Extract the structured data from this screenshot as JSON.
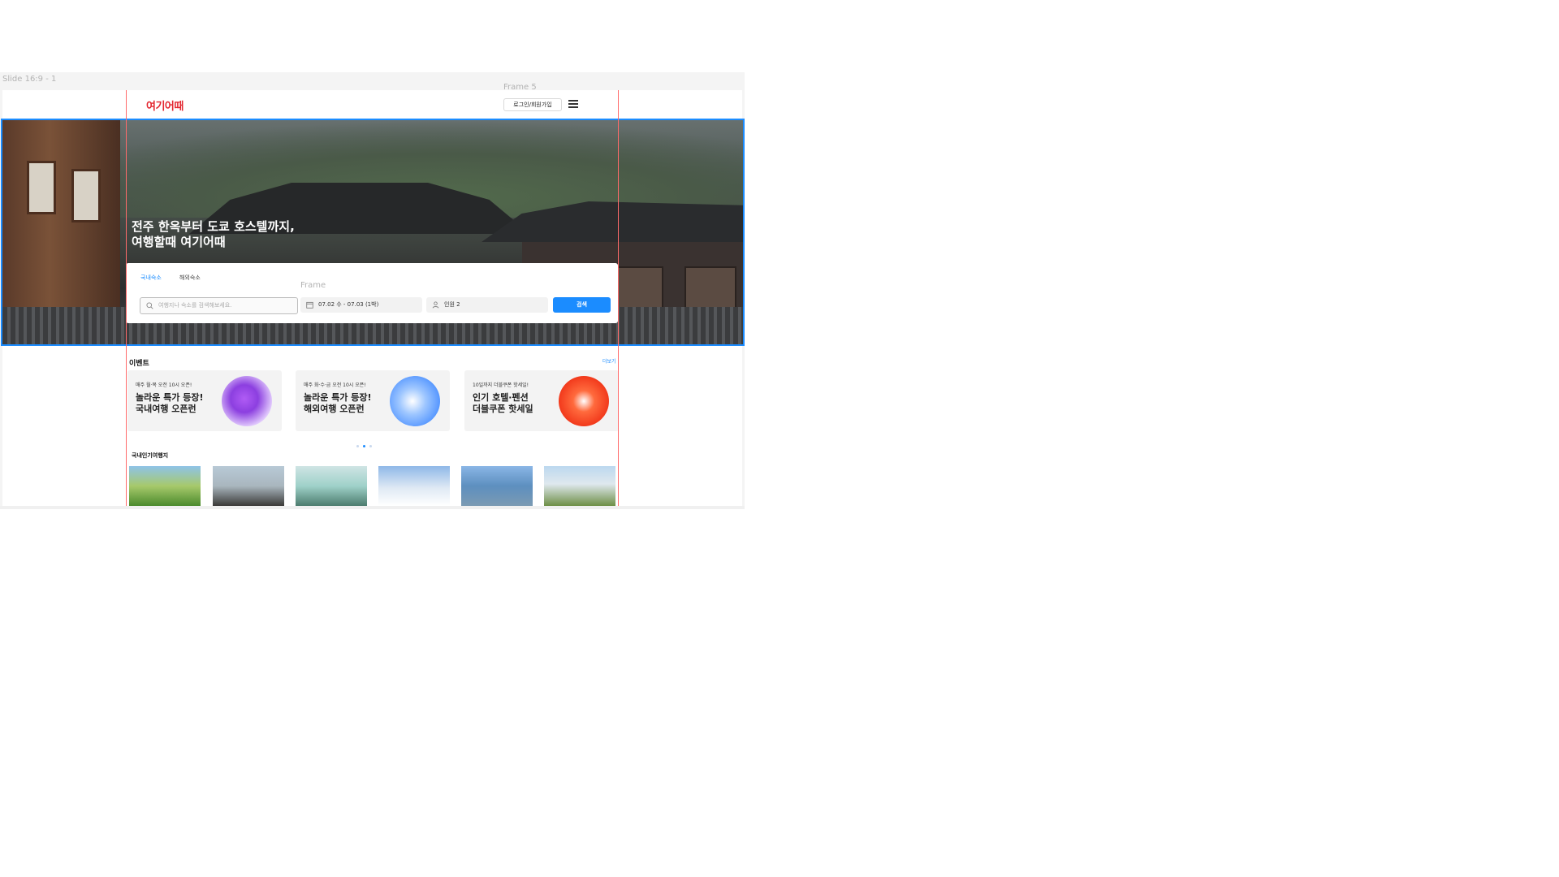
{
  "canvas": {
    "slide_label": "Slide 16:9 - 1",
    "frame_label": "Frame 5",
    "inner_frame_label": "Frame"
  },
  "header": {
    "logo": "여기어때",
    "login_label": "로그인/회원가입",
    "menu_icon": "hamburger-menu-icon"
  },
  "hero": {
    "title_line1": "전주 한옥부터 도쿄 호스텔까지,",
    "title_line2": "여행할때 여기어때"
  },
  "search": {
    "tabs": [
      "국내숙소",
      "해외숙소"
    ],
    "active_tab": "국내숙소",
    "placeholder": "여행지나 숙소를 검색해보세요.",
    "dates": "07.02 수 - 07.03 (1박)",
    "people": "인원 2",
    "button": "검색",
    "accent": "#1b8cff"
  },
  "events": {
    "title": "이벤트",
    "more": "더보기",
    "cards": [
      {
        "small": "매주 월·목 오전 10시 오픈!",
        "line1": "놀라운 특가 등장!",
        "line2": "국내여행 오픈런"
      },
      {
        "small": "매주 화·수·금 오전 10시 오픈!",
        "line1": "놀라운 특가 등장!",
        "line2": "해외여행 오픈런"
      },
      {
        "small": "10일까지 더블쿠폰 핫세일!",
        "line1": "인기 호텔·펜션",
        "line2": "더블쿠폰 핫세일"
      }
    ],
    "pager": {
      "count": 3,
      "active": 2
    }
  },
  "popular": {
    "title": "국내인기여행지"
  }
}
